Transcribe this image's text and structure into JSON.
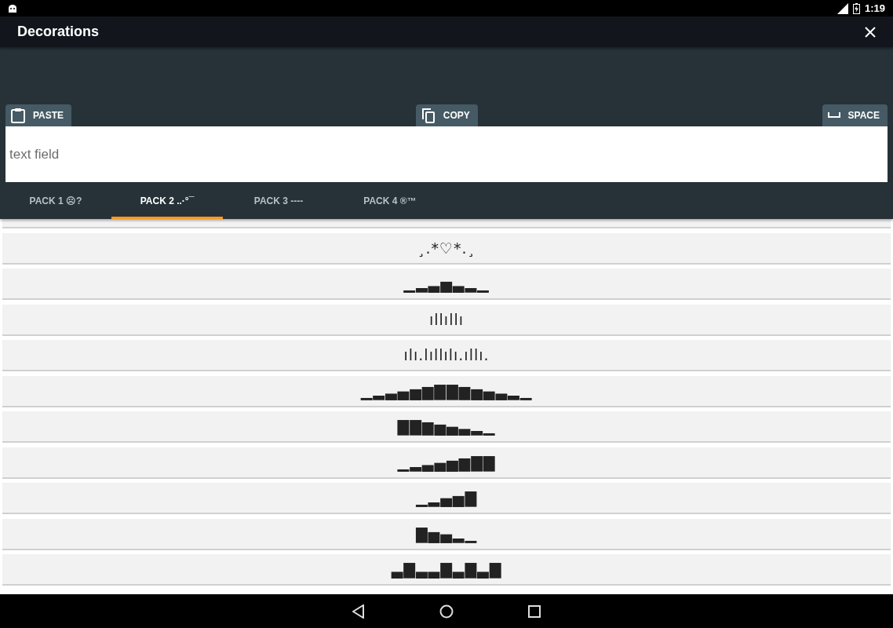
{
  "status_bar": {
    "time": "1:19"
  },
  "app_bar": {
    "title": "Decorations"
  },
  "toolbar": {
    "buttons": [
      {
        "kind": "paste",
        "label": "PASTE"
      },
      {
        "kind": "copy",
        "label": "COPY"
      },
      {
        "kind": "space",
        "label": "SPACE"
      }
    ]
  },
  "text_field": {
    "placeholder": "text field"
  },
  "tabs": [
    {
      "label": "PACK 1 ☹?",
      "selected": false
    },
    {
      "label": "PACK 2 ..·°¯",
      "selected": true
    },
    {
      "label": "PACK 3 ----",
      "selected": false
    },
    {
      "label": "PACK 4 ®™",
      "selected": false
    }
  ],
  "decorations": [
    {
      "kind": "cut"
    },
    {
      "kind": "text",
      "text": "¸.*♡*.¸"
    },
    {
      "kind": "text",
      "text": "▁▂▃▅▃▂▁"
    },
    {
      "kind": "text",
      "text": "ıllıllı"
    },
    {
      "kind": "text",
      "text": "ılı.lıllılı.ıllı."
    },
    {
      "kind": "text",
      "text": "▁▂▃▄▅▆▇▇▆▅▄▃▂▁"
    },
    {
      "kind": "text",
      "text": "▇▇▆▅▄▃▂▁"
    },
    {
      "kind": "text",
      "text": "▁▂▃▄▅▆▇▇"
    },
    {
      "kind": "text",
      "text": "▁▂▄▅▇"
    },
    {
      "kind": "text",
      "text": "▇▅▄▂▁"
    },
    {
      "kind": "text",
      "text": "▃▇▃▃▇▃▇▃▇"
    }
  ]
}
